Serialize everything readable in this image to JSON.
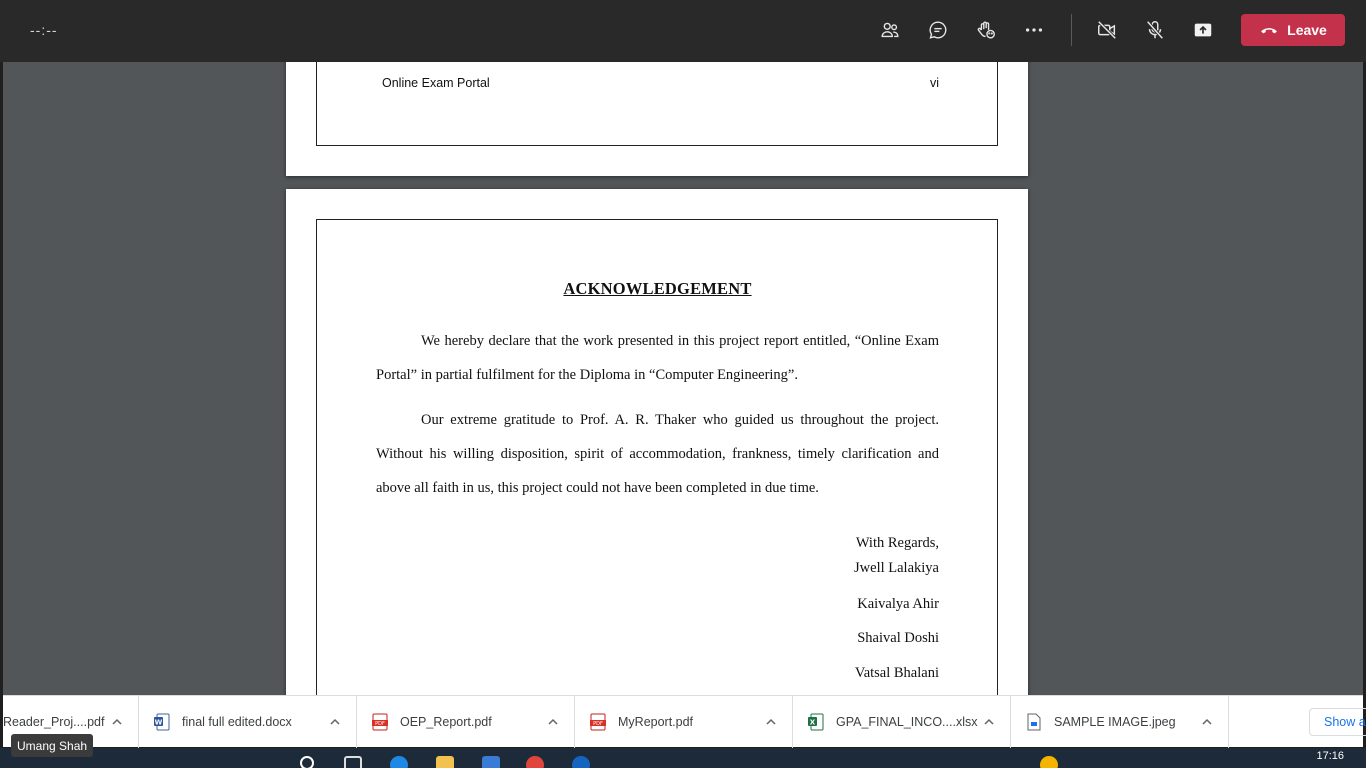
{
  "meeting": {
    "timer": "--:--",
    "leave_label": "Leave",
    "participant_name": "Umang Shah",
    "icons": [
      "people-icon",
      "chat-icon",
      "raise-hand-icon",
      "more-icon",
      "camera-off-icon",
      "mic-off-icon",
      "share-screen-icon"
    ]
  },
  "document": {
    "prev_page_footer_left": "Online Exam Portal",
    "prev_page_footer_right": "vi",
    "title": "ACKNOWLEDGEMENT",
    "para1": "We hereby declare that the work presented in this project report entitled, “Online Exam Portal” in partial fulfilment for the Diploma in “Computer Engineering”.",
    "para2": "Our extreme gratitude to Prof. A. R. Thaker who guided us throughout the project. Without his willing disposition, spirit of accommodation, frankness, timely clarification and above all faith in us, this project could not have been completed in due time.",
    "closing": "With Regards,",
    "signatories": [
      "Jwell Lalakiya",
      "Kaivalya Ahir",
      "Shaival Doshi",
      "Vatsal Bhalani"
    ]
  },
  "downloads": {
    "items": [
      {
        "name": "Reader_Proj....pdf",
        "type": "pdf"
      },
      {
        "name": "final full edited.docx",
        "type": "docx"
      },
      {
        "name": "OEP_Report.pdf",
        "type": "pdf"
      },
      {
        "name": "MyReport.pdf",
        "type": "pdf"
      },
      {
        "name": "GPA_FINAL_INCO....xlsx",
        "type": "xlsx"
      },
      {
        "name": "SAMPLE IMAGE.jpeg",
        "type": "jpeg"
      }
    ],
    "show_all_label": "Show all"
  },
  "taskbar": {
    "clock": "17:16"
  },
  "colors": {
    "leave": "#c4314b",
    "viewer_bg": "#525659",
    "topbar": "#292929",
    "link": "#1a73e8"
  }
}
